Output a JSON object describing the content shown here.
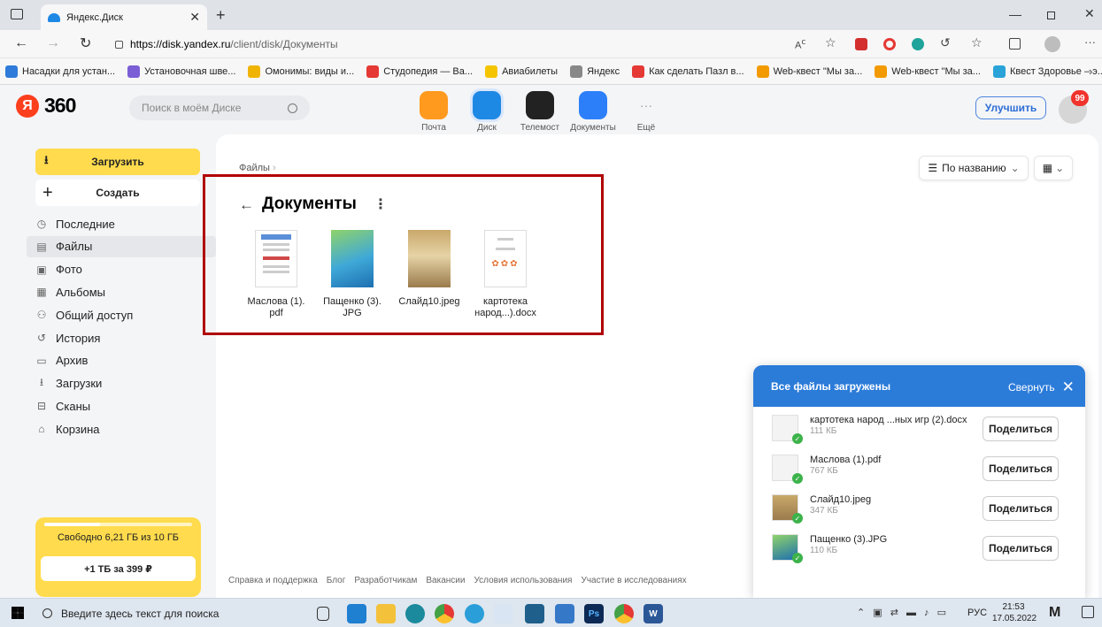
{
  "browser": {
    "tab_title": "Яндекс.Диск",
    "url_host": "https://disk.yandex.ru",
    "url_path": "/client/disk/Документы",
    "bookmarks": [
      {
        "label": "Насадки для устан...",
        "icon": "globe-icon",
        "color": "#2f7bd9"
      },
      {
        "label": "Установочная шве...",
        "icon": "w-icon",
        "color": "#7b5ed6"
      },
      {
        "label": "Омонимы: виды и...",
        "icon": "sun-icon",
        "color": "#f0b400"
      },
      {
        "label": "Студопедия — Ва...",
        "icon": "s-icon",
        "color": "#e53935"
      },
      {
        "label": "Авиабилеты",
        "icon": "plane-icon",
        "color": "#f5c400"
      },
      {
        "label": "Яндекс",
        "icon": "page-icon",
        "color": "#888888"
      },
      {
        "label": "Как сделать Пазл в...",
        "icon": "youtube-icon",
        "color": "#e53935"
      },
      {
        "label": "Web-квест \"Мы за...",
        "icon": "b-icon",
        "color": "#f29a00"
      },
      {
        "label": "Web-квест \"Мы за...",
        "icon": "b-icon",
        "color": "#f29a00"
      },
      {
        "label": "Квест Здоровье – э...",
        "icon": "quest-icon",
        "color": "#2aa3d9"
      }
    ]
  },
  "header": {
    "logo_text": "360",
    "search_placeholder": "Поиск в моём Диске",
    "apps": [
      {
        "label": "Почта",
        "icon": "mail-icon",
        "color": "#ff9a1f"
      },
      {
        "label": "Диск",
        "icon": "disk-icon",
        "color": "#1e88e5"
      },
      {
        "label": "Телемост",
        "icon": "telemost-icon",
        "color": "#222222"
      },
      {
        "label": "Документы",
        "icon": "documents-icon",
        "color": "#2d7ff9"
      },
      {
        "label": "Ещё",
        "icon": "more-icon",
        "color": "#999999"
      }
    ],
    "upgrade_label": "Улучшить",
    "notification_count": "99"
  },
  "sidebar": {
    "upload_label": "Загрузить",
    "create_label": "Создать",
    "items": [
      {
        "label": "Последние",
        "icon": "clock-icon"
      },
      {
        "label": "Файлы",
        "icon": "file-icon"
      },
      {
        "label": "Фото",
        "icon": "photo-icon"
      },
      {
        "label": "Альбомы",
        "icon": "albums-icon"
      },
      {
        "label": "Общий доступ",
        "icon": "shared-icon"
      },
      {
        "label": "История",
        "icon": "history-icon"
      },
      {
        "label": "Архив",
        "icon": "archive-icon"
      },
      {
        "label": "Загрузки",
        "icon": "download-icon"
      },
      {
        "label": "Сканы",
        "icon": "scan-icon"
      },
      {
        "label": "Корзина",
        "icon": "trash-icon"
      }
    ],
    "storage_text": "Свободно 6,21 ГБ из 10 ГБ",
    "storage_used_fraction": 0.38,
    "offer_label": "+1 ТБ за 399 ₽"
  },
  "main": {
    "breadcrumb": "Файлы",
    "folder_title": "Документы",
    "sort_label": "По названию",
    "files": [
      {
        "name_line1": "Маслова (1).",
        "name_line2": "pdf"
      },
      {
        "name_line1": "Пащенко (3).",
        "name_line2": "JPG"
      },
      {
        "name_line1": "Слайд10.jpeg",
        "name_line2": ""
      },
      {
        "name_line1": "картотека",
        "name_line2": "народ...).docx"
      }
    ],
    "footer_links": [
      "Справка и поддержка",
      "Блог",
      "Разработчикам",
      "Вакансии",
      "Условия использования",
      "Участие в исследованиях"
    ]
  },
  "upload_panel": {
    "title": "Все файлы загружены",
    "collapse_label": "Свернуть",
    "share_label": "Поделиться",
    "items": [
      {
        "name": "картотека народ ...ных игр (2).docx",
        "size": "111 КБ"
      },
      {
        "name": "Маслова (1).pdf",
        "size": "767 КБ"
      },
      {
        "name": "Слайд10.jpeg",
        "size": "347 КБ"
      },
      {
        "name": "Пащенко (3).JPG",
        "size": "110 КБ"
      }
    ]
  },
  "taskbar": {
    "search_placeholder": "Введите здесь текст для поиска",
    "lang": "РУС",
    "time": "21:53",
    "date": "17.05.2022"
  },
  "colors": {
    "highlight_frame": "#b00000",
    "accent_yellow": "#ffdb4d",
    "panel_blue": "#2b7bd9"
  }
}
